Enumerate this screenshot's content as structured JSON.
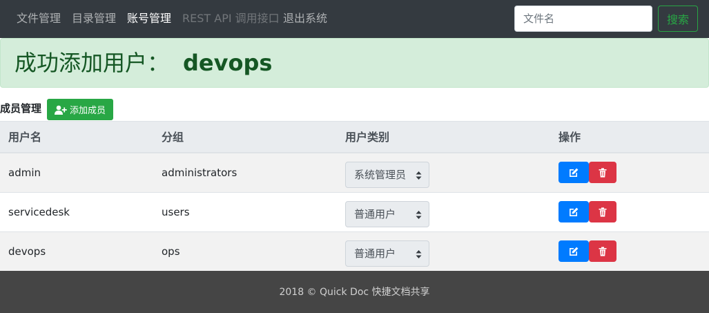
{
  "nav": {
    "items": [
      {
        "label": "文件管理",
        "state": "normal"
      },
      {
        "label": "目录管理",
        "state": "normal"
      },
      {
        "label": "账号管理",
        "state": "active"
      },
      {
        "label": "REST API 调用接口",
        "state": "disabled"
      },
      {
        "label": "退出系统",
        "state": "normal"
      }
    ],
    "search_placeholder": "文件名",
    "search_button_label": "搜索"
  },
  "alert": {
    "message": "成功添加用户：",
    "username": "devops"
  },
  "members": {
    "title": "成员管理",
    "add_button_label": "添加成员",
    "add_button_icon": "user-plus-icon",
    "columns": [
      "用户名",
      "分组",
      "用户类别",
      "操作"
    ],
    "rows": [
      {
        "username": "admin",
        "group": "administrators",
        "role": "系统管理员"
      },
      {
        "username": "servicedesk",
        "group": "users",
        "role": "普通用户"
      },
      {
        "username": "devops",
        "group": "ops",
        "role": "普通用户"
      }
    ],
    "edit_icon": "edit-icon",
    "delete_icon": "trash-icon"
  },
  "footer": {
    "text": "2018 © Quick Doc 快捷文档共享"
  },
  "colors": {
    "navbar_bg": "#343a40",
    "alert_bg": "#d4edda",
    "alert_text": "#155724",
    "success": "#28a745",
    "primary": "#007bff",
    "danger": "#dc3545",
    "footer_bg": "#454545"
  }
}
